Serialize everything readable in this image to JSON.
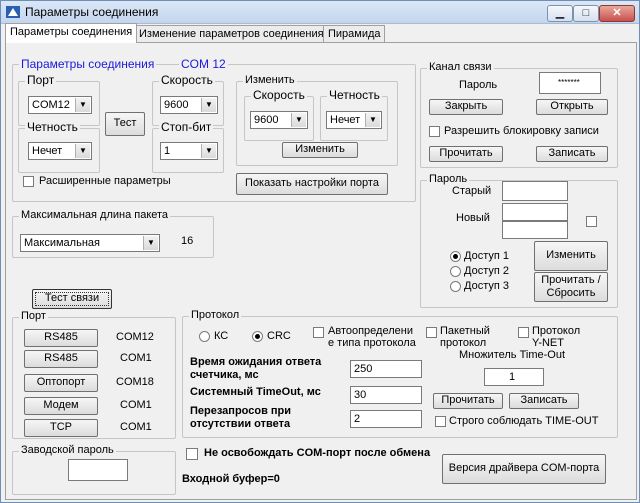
{
  "window": {
    "title": "Параметры соединения"
  },
  "tabs": [
    "Параметры соединения",
    "Изменение параметров соединения",
    "Пирамида"
  ],
  "conn": {
    "group_title": "Параметры соединения",
    "com_label": "COM 12",
    "port_label": "Порт",
    "port_value": "COM12",
    "speed_label": "Скорость",
    "speed_value": "9600",
    "parity_label": "Четность",
    "parity_value": "Нечет",
    "stopbit_label": "Стоп-бит",
    "stopbit_value": "1",
    "test_label": "Тест",
    "change_group": "Изменить",
    "change_speed_label": "Скорость",
    "change_speed_value": "9600",
    "change_parity_label": "Четность",
    "change_parity_value": "Нечет",
    "change_button": "Изменить",
    "extended_params": "Расширенные параметры",
    "show_port_settings": "Показать настройки порта"
  },
  "max_packet": {
    "title": "Максимальная длина пакета",
    "value": "Максимальная",
    "number": "16"
  },
  "channel": {
    "title": "Канал связи",
    "password_label": "Пароль",
    "password_value": "*******",
    "close": "Закрыть",
    "open": "Открыть",
    "allow_block": "Разрешить блокировку записи",
    "read": "Прочитать",
    "write": "Записать"
  },
  "password": {
    "title": "Пароль",
    "old_label": "Старый",
    "new_label": "Новый",
    "access1": "Доступ 1",
    "access2": "Доступ 2",
    "access3": "Доступ 3",
    "change": "Изменить",
    "read_reset": "Прочитать / Сбросить"
  },
  "test_link": "Тест связи",
  "port_list": {
    "title": "Порт",
    "items": [
      {
        "name": "RS485",
        "com": "COM12"
      },
      {
        "name": "RS485",
        "com": "COM1"
      },
      {
        "name": "Оптопорт",
        "com": "COM18"
      },
      {
        "name": "Модем",
        "com": "COM1"
      },
      {
        "name": "TCP",
        "com": "COM1"
      }
    ]
  },
  "protocol": {
    "title": "Протокол",
    "kc": "КС",
    "crc": "CRC",
    "auto_detect": "Автоопределени е типа протокола",
    "packet_protocol": "Пакетный протокол",
    "ynet_protocol": "Протокол Y-NET",
    "wait_label": "Время ожидания ответа счетчика, мс",
    "wait_value": "250",
    "sys_timeout_label": "Системный TimeOut, мс",
    "sys_timeout_value": "30",
    "retries_label": "Перезапросов при отсутствии ответа",
    "retries_value": "2",
    "multiplier_label": "Множитель Time-Out счетчика",
    "multiplier_value": "1",
    "read": "Прочитать",
    "write": "Записать",
    "strict_timeout": "Строго соблюдать TIME-OUT"
  },
  "factory_password": {
    "title": "Заводской пароль"
  },
  "keep_com_port": "Не освобождать COM-порт после обмена",
  "input_buffer": "Входной буфер=0",
  "driver_version": "Версия драйвера COM-порта",
  "colors": {
    "accent": "#1a1adc",
    "title_bg": "#c3d5ee"
  }
}
